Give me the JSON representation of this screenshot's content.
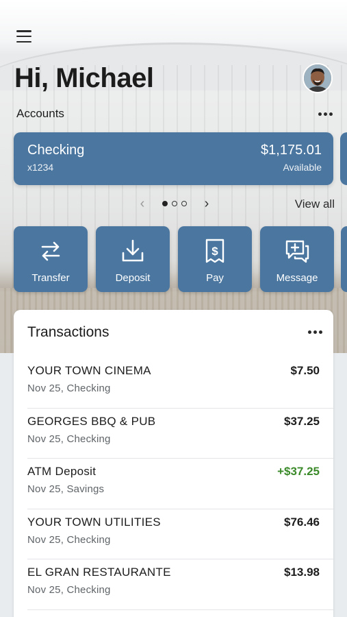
{
  "header": {
    "greeting": "Hi, Michael",
    "accounts_label": "Accounts",
    "menu_icon": "hamburger-menu-icon",
    "avatar": "user-avatar",
    "more_icon": "more-horizontal-icon"
  },
  "accounts": [
    {
      "name": "Checking",
      "number": "x1234",
      "balance": "$1,175.01",
      "balance_label": "Available"
    }
  ],
  "pager": {
    "prev_icon": "chevron-left-icon",
    "next_icon": "chevron-right-icon",
    "page_count": 3,
    "active_page": 1,
    "view_all": "View all"
  },
  "actions": [
    {
      "label": "Transfer",
      "icon": "transfer-arrows-icon"
    },
    {
      "label": "Deposit",
      "icon": "download-deposit-icon"
    },
    {
      "label": "Pay",
      "icon": "bill-receipt-icon"
    },
    {
      "label": "Message",
      "icon": "chat-message-icon"
    }
  ],
  "transactions": {
    "title": "Transactions",
    "items": [
      {
        "merchant": "YOUR TOWN CINEMA",
        "meta": "Nov 25, Checking",
        "amount": "$7.50",
        "credit": false
      },
      {
        "merchant": "GEORGES BBQ & PUB",
        "meta": "Nov 25, Checking",
        "amount": "$37.25",
        "credit": false
      },
      {
        "merchant": "ATM Deposit",
        "meta": "Nov 25, Savings",
        "amount": "+$37.25",
        "credit": true
      },
      {
        "merchant": "YOUR TOWN UTILITIES",
        "meta": "Nov 25, Checking",
        "amount": "$76.46",
        "credit": false
      },
      {
        "merchant": "EL GRAN RESTAURANTE",
        "meta": "Nov 25, Checking",
        "amount": "$13.98",
        "credit": false
      }
    ]
  },
  "colors": {
    "accent": "#4a76a0",
    "credit": "#3b8a2a",
    "background": "#e9ecef"
  }
}
